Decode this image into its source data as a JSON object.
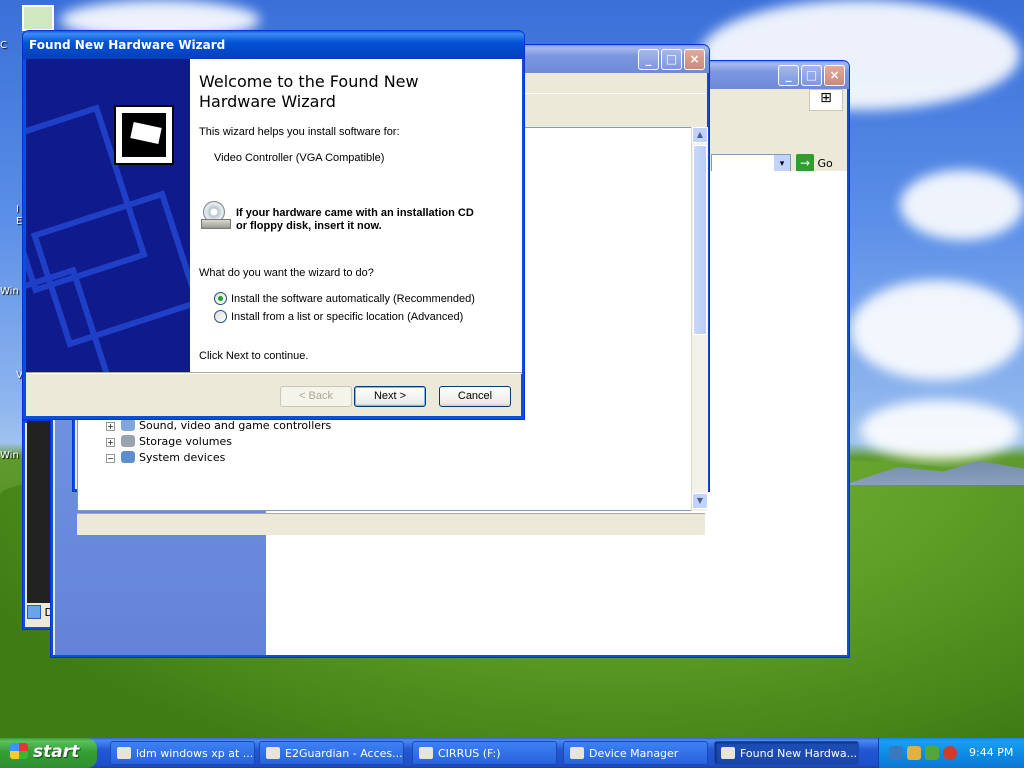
{
  "desktop": {
    "top_icon_label": "",
    "partial_labels": [
      "C",
      "I",
      "E",
      "Win",
      "V",
      "Win"
    ]
  },
  "explorer_window": {
    "go_label": "Go"
  },
  "device_manager": {
    "tree_items": [
      {
        "label": "Sound, video and game controllers",
        "expand": "+"
      },
      {
        "label": "Storage volumes",
        "expand": "+"
      },
      {
        "label": "System devices",
        "expand": "−"
      }
    ],
    "bottom_window_label": "D"
  },
  "wizard": {
    "title": "Found New Hardware Wizard",
    "heading": "Welcome to the Found New Hardware Wizard",
    "intro": "This wizard helps you install software for:",
    "device": "Video Controller (VGA Compatible)",
    "cd_notice_line1": "If your hardware came with an installation CD",
    "cd_notice_line2": "or floppy disk, insert it now.",
    "question": "What do you want the wizard to do?",
    "options": [
      {
        "label": "Install the software automatically (Recommended)",
        "selected": true
      },
      {
        "label": "Install from a list or specific location (Advanced)",
        "selected": false
      }
    ],
    "footer": "Click Next to continue.",
    "buttons": {
      "back": "< Back",
      "next": "Next >",
      "cancel": "Cancel"
    }
  },
  "taskbar": {
    "start_label": "start",
    "tasks": [
      {
        "label": "ldm windows xp at ...",
        "active": false
      },
      {
        "label": "E2Guardian - Acces...",
        "active": false
      },
      {
        "label": "CIRRUS (F:)",
        "active": false
      },
      {
        "label": "Device Manager",
        "active": false
      },
      {
        "label": "Found New Hardwa...",
        "active": true
      }
    ],
    "clock": "9:44 PM"
  },
  "colors": {
    "title_blue": "#0553d6",
    "wizard_side": "#0f1a8c",
    "start_green": "#35a035",
    "close_red": "#c4391b"
  }
}
